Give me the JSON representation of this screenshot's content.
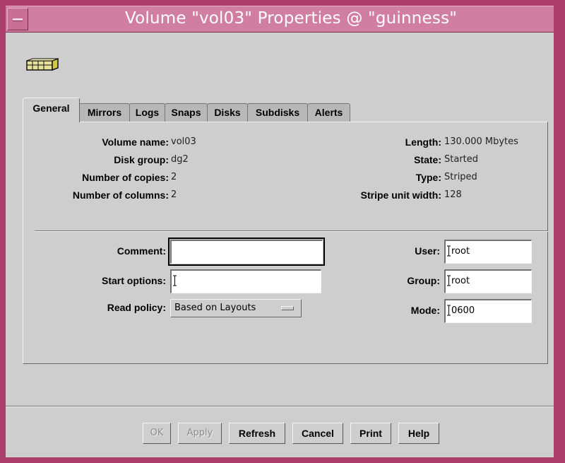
{
  "window": {
    "title": "Volume \"vol03\" Properties @ \"guinness\"",
    "colors": {
      "frame": "#ab3e6a",
      "titlebar": "#d17ea3",
      "client": "#cecece"
    }
  },
  "app_icon": "volume-icon",
  "tabs": [
    {
      "label": "General",
      "active": true
    },
    {
      "label": "Mirrors"
    },
    {
      "label": "Logs"
    },
    {
      "label": "Snaps"
    },
    {
      "label": "Disks"
    },
    {
      "label": "Subdisks"
    },
    {
      "label": "Alerts"
    }
  ],
  "info_left": [
    {
      "label": "Volume name:",
      "value": "vol03"
    },
    {
      "label": "Disk group:",
      "value": "dg2"
    },
    {
      "label": "Number of copies:",
      "value": "2"
    },
    {
      "label": "Number of columns:",
      "value": "2"
    }
  ],
  "info_right": [
    {
      "label": "Length:",
      "value": "130.000 Mbytes"
    },
    {
      "label": "State:",
      "value": "Started"
    },
    {
      "label": "Type:",
      "value": "Striped"
    },
    {
      "label": "Stripe unit width:",
      "value": "128"
    }
  ],
  "form": {
    "comment": {
      "label": "Comment:",
      "value": ""
    },
    "start_options": {
      "label": "Start options:",
      "value": ""
    },
    "read_policy": {
      "label": "Read policy:",
      "value": "Based on Layouts"
    },
    "user": {
      "label": "User:",
      "value": "root"
    },
    "group": {
      "label": "Group:",
      "value": "root"
    },
    "mode": {
      "label": "Mode:",
      "value": "0600"
    }
  },
  "buttons": {
    "ok": "OK",
    "apply": "Apply",
    "refresh": "Refresh",
    "cancel": "Cancel",
    "print": "Print",
    "help": "Help"
  }
}
